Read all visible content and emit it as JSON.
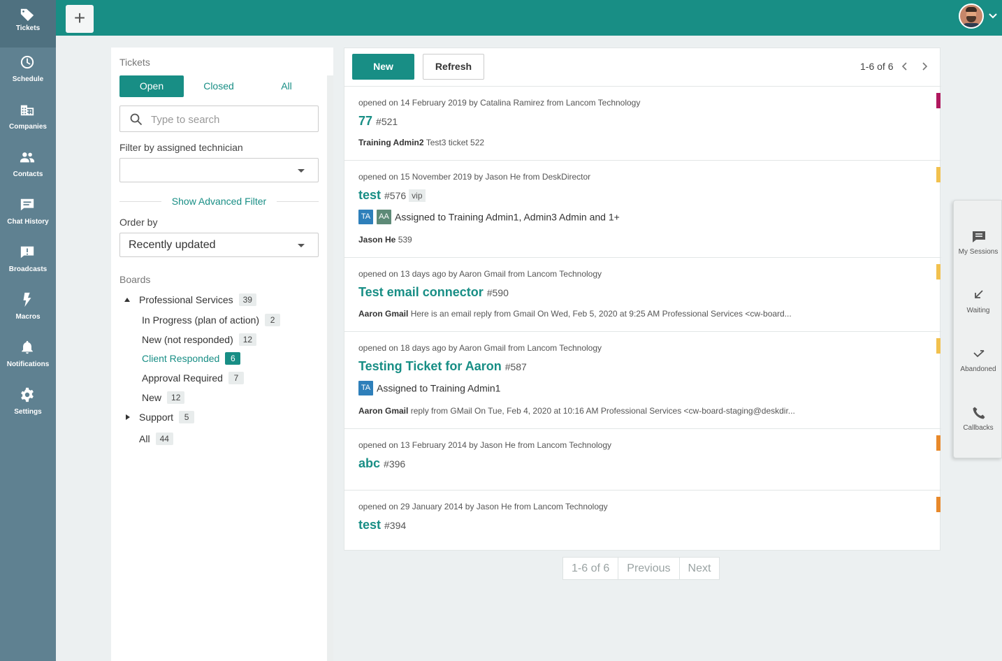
{
  "nav": {
    "items": [
      {
        "label": "Tickets",
        "icon": "tag-icon"
      },
      {
        "label": "Schedule",
        "icon": "clock-icon"
      },
      {
        "label": "Companies",
        "icon": "building-icon"
      },
      {
        "label": "Contacts",
        "icon": "people-icon"
      },
      {
        "label": "Chat History",
        "icon": "chat-icon"
      },
      {
        "label": "Broadcasts",
        "icon": "broadcast-icon"
      },
      {
        "label": "Macros",
        "icon": "bolt-icon"
      },
      {
        "label": "Notifications",
        "icon": "bell-icon"
      },
      {
        "label": "Settings",
        "icon": "gear-icon"
      }
    ],
    "active": "Tickets"
  },
  "topbar": {
    "add_label": "+",
    "accent": "#188e85"
  },
  "filter": {
    "title": "Tickets",
    "tabs": [
      {
        "label": "Open",
        "active": true
      },
      {
        "label": "Closed",
        "active": false
      },
      {
        "label": "All",
        "active": false
      }
    ],
    "search": {
      "placeholder": "Type to search",
      "value": ""
    },
    "technician": {
      "label": "Filter by assigned technician",
      "value": ""
    },
    "advanced_label": "Show Advanced Filter",
    "order": {
      "label": "Order by",
      "value": "Recently updated"
    },
    "boards_title": "Boards",
    "boards": [
      {
        "name": "Professional Services",
        "count": "39",
        "expanded": true
      },
      {
        "name": "In Progress (plan of action)",
        "count": "2"
      },
      {
        "name": "New (not responded)",
        "count": "12"
      },
      {
        "name": "Client Responded",
        "count": "6",
        "selected": true
      },
      {
        "name": "Approval Required",
        "count": "7"
      },
      {
        "name": "New",
        "count": "12"
      },
      {
        "name": "Support",
        "count": "5",
        "expanded": false
      },
      {
        "name": "All",
        "count": "44"
      }
    ]
  },
  "toolbar": {
    "new_label": "New",
    "refresh_label": "Refresh",
    "page_info": "1-6 of 6"
  },
  "tickets": [
    {
      "meta": "opened on 14 February 2019 by Catalina Ramirez from Lancom Technology",
      "title": "77",
      "number": "#521",
      "last_author": "Training Admin2",
      "last_text": "Test3 ticket 522",
      "priority_color": "#b0185e"
    },
    {
      "meta": "opened on 15 November 2019 by Jason He from DeskDirector",
      "title": "test",
      "number": "#576",
      "tag": "vip",
      "avatars": [
        "TA",
        "AA"
      ],
      "assigned": "Assigned to Training Admin1, Admin3 Admin and 1+",
      "last_author": "Jason He",
      "last_text": "539",
      "priority_color": "#f2c14e"
    },
    {
      "meta": "opened on 13 days ago by Aaron Gmail from Lancom Technology",
      "title": "Test email connector",
      "number": "#590",
      "last_author": "Aaron Gmail",
      "last_text": "Here is an email reply from Gmail On Wed, Feb 5, 2020 at 9:25 AM Professional Services <cw-board...",
      "priority_color": "#f2c14e"
    },
    {
      "meta": "opened on 18 days ago by Aaron Gmail from Lancom Technology",
      "title": "Testing Ticket for Aaron",
      "number": "#587",
      "avatars": [
        "TA"
      ],
      "assigned": "Assigned to Training Admin1",
      "last_author": "Aaron Gmail",
      "last_text": "reply from GMail On Tue, Feb 4, 2020 at 10:16 AM Professional Services <cw-board-staging@deskdir...",
      "priority_color": "#f2c14e"
    },
    {
      "meta": "opened on 13 February 2014 by Jason He from Lancom Technology",
      "title": "abc",
      "number": "#396",
      "priority_color": "#e8892b"
    },
    {
      "meta": "opened on 29 January 2014 by Jason He from Lancom Technology",
      "title": "test",
      "number": "#394",
      "priority_color": "#e8892b"
    }
  ],
  "pager": {
    "info": "1-6 of 6",
    "previous": "Previous",
    "next": "Next"
  },
  "sessions": {
    "items": [
      {
        "label": "My Sessions",
        "icon": "chat-icon"
      },
      {
        "label": "Waiting",
        "icon": "arrow-down-left-icon"
      },
      {
        "label": "Abandoned",
        "icon": "check-arrow-icon"
      },
      {
        "label": "Callbacks",
        "icon": "phone-icon"
      }
    ]
  }
}
